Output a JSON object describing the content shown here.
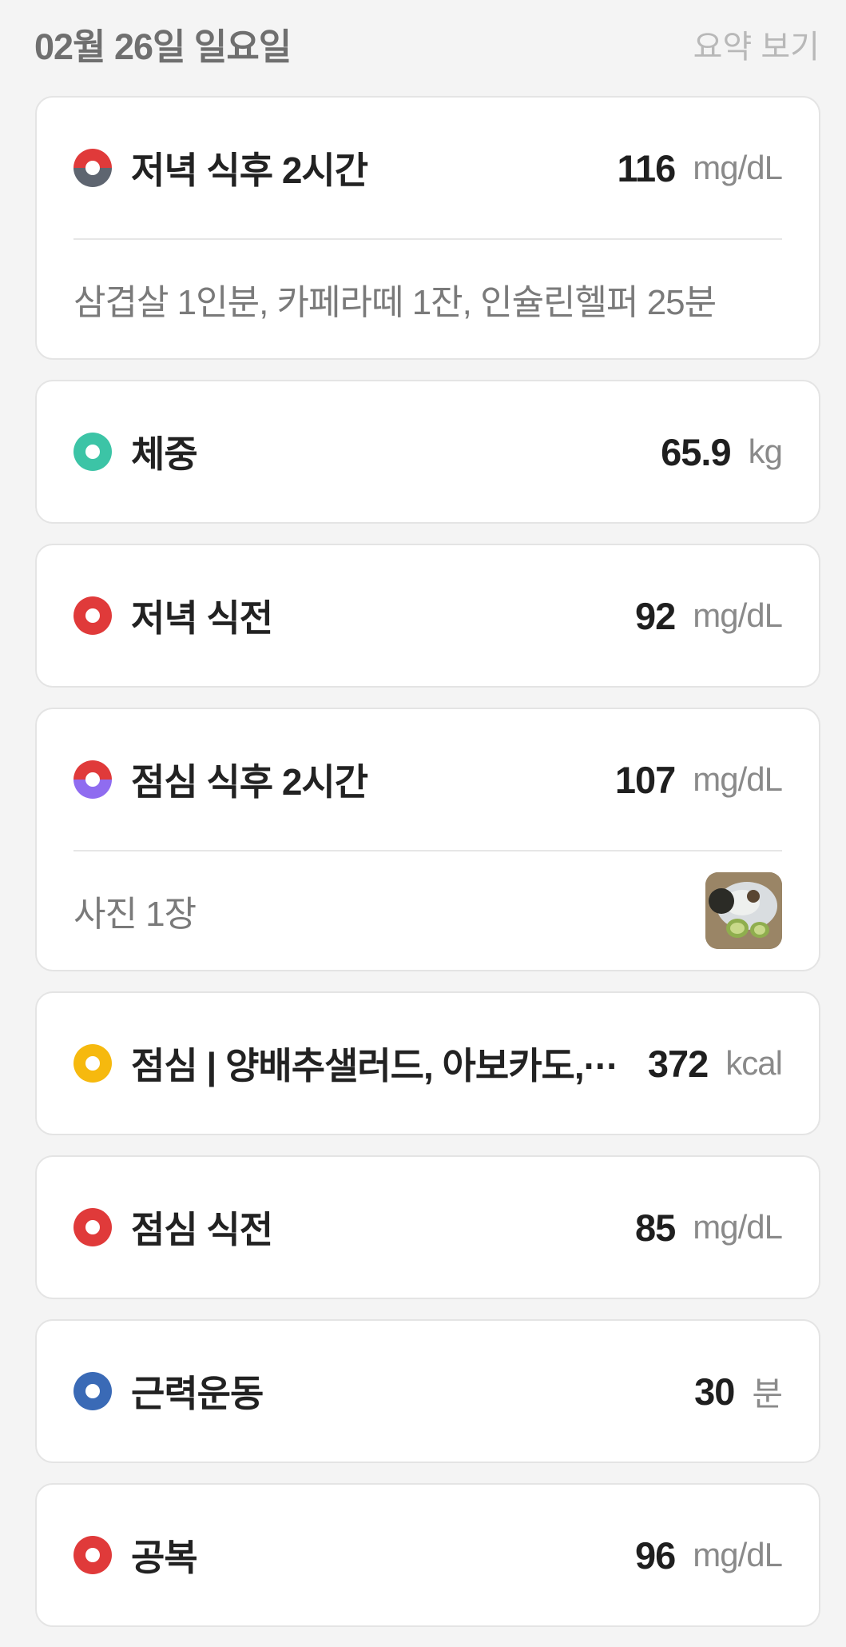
{
  "header": {
    "date": "02월 26일 일요일",
    "summary_label": "요약 보기"
  },
  "records": [
    {
      "label": "저녁 식후 2시간",
      "value": "116",
      "unit": "mg/dL",
      "icon": "split-gray",
      "detail": "삼겹살 1인분, 카페라떼 1잔, 인슐린헬퍼 25분"
    },
    {
      "label": "체중",
      "value": "65.9",
      "unit": "kg",
      "icon": "teal"
    },
    {
      "label": "저녁 식전",
      "value": "92",
      "unit": "mg/dL",
      "icon": "red"
    },
    {
      "label": "점심 식후 2시간",
      "value": "107",
      "unit": "mg/dL",
      "icon": "split-purple",
      "detail": "사진 1장"
    },
    {
      "label": "점심 | 양배추샐러드, 아보카도,···",
      "value": "372",
      "unit": "kcal",
      "icon": "yellow"
    },
    {
      "label": "점심 식전",
      "value": "85",
      "unit": "mg/dL",
      "icon": "red"
    },
    {
      "label": "근력운동",
      "value": "30",
      "unit": "분",
      "icon": "blue"
    },
    {
      "label": "공복",
      "value": "96",
      "unit": "mg/dL",
      "icon": "red"
    }
  ],
  "colors": {
    "glucose_red": "#e03a3a",
    "weight_teal": "#3cc4a6",
    "meal_yellow": "#f6b90e",
    "exercise_blue": "#3a6ab6",
    "post_meal_purple": "#8f6cf0",
    "post_meal_gray": "#5e6570"
  }
}
